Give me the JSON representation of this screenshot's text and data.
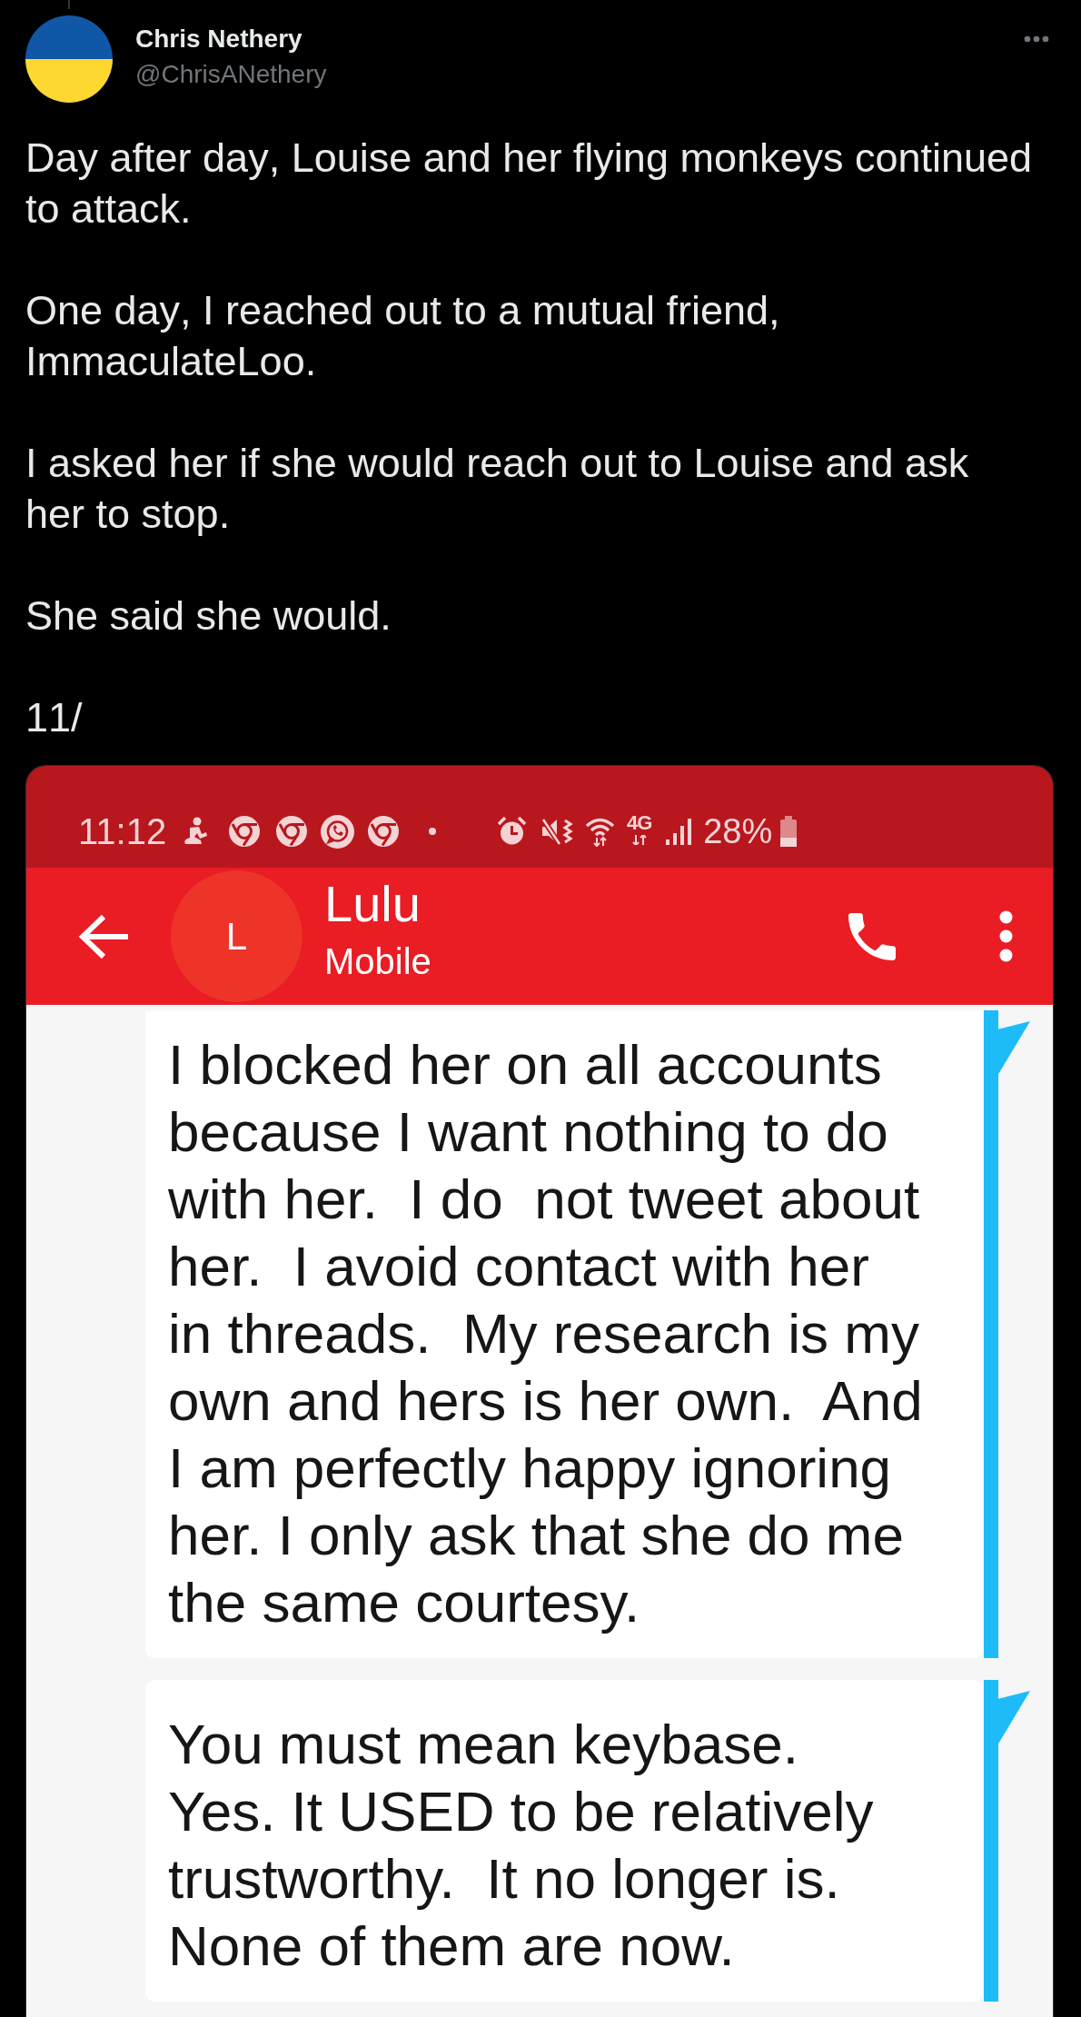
{
  "tweet": {
    "author": {
      "name": "Chris Nethery",
      "handle": "@ChrisANethery"
    },
    "paragraphs": [
      "Day after day, Louise and her flying monkeys continued to attack.",
      "One day, I reached out to a mutual friend, ImmaculateLoo.",
      "I asked her if she would reach out to Louise and ask her to stop.",
      "She said she would.",
      "11/"
    ]
  },
  "screenshot": {
    "status_bar": {
      "time": "11:12",
      "network": "4G",
      "battery": "28%"
    },
    "app_bar": {
      "avatar_letter": "L",
      "contact_name": "Lulu",
      "contact_label": "Mobile"
    },
    "messages": [
      {
        "text": "I blocked her on all accounts\nbecause I want nothing to do\nwith her.  I do  not tweet about\nher.  I avoid contact with her\nin threads.  My research is my\nown and hers is her own.  And\nI am perfectly happy ignoring\nher. I only ask that she do me\nthe same courtesy."
      },
      {
        "text": "You must mean keybase.\nYes. It USED to be relatively\ntrustworthy.  It no longer is.\nNone of them are now."
      }
    ]
  }
}
